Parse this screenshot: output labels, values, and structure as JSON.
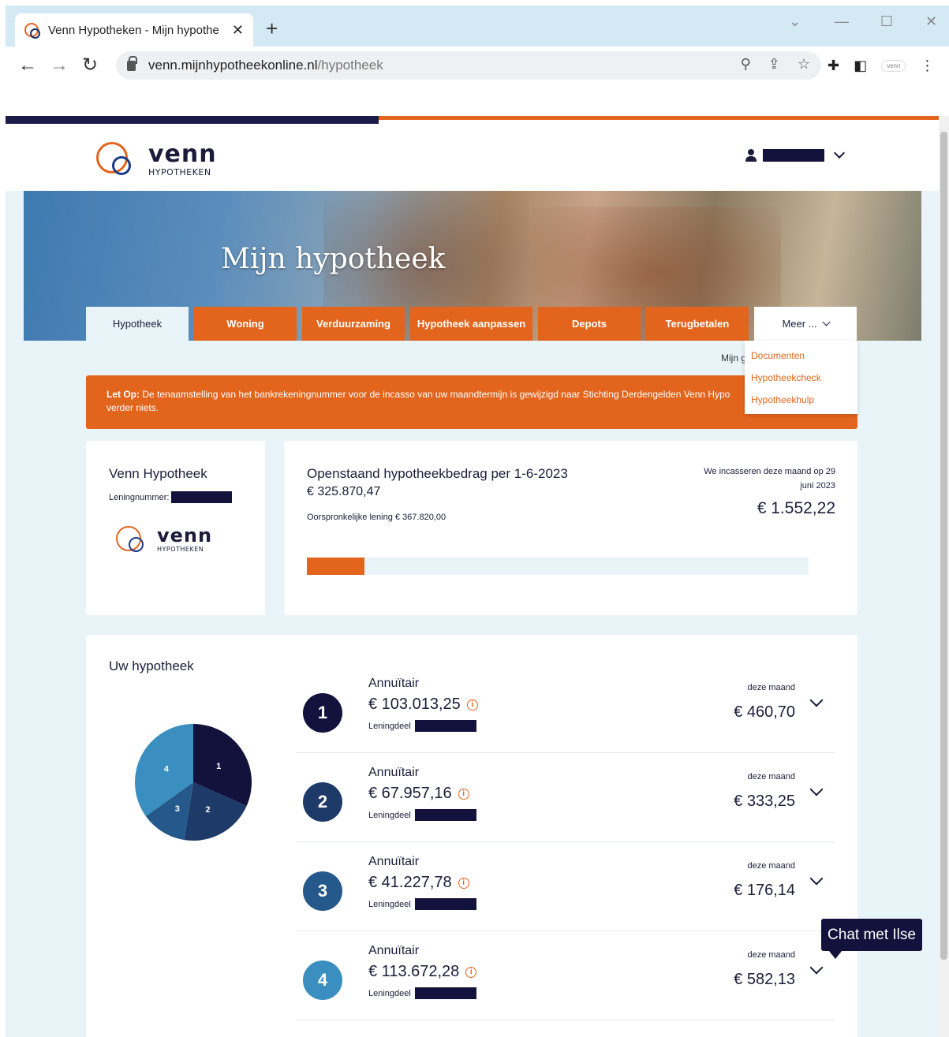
{
  "browser": {
    "tab_title": "Venn Hypotheken - Mijn hypothe",
    "close_label": "✕",
    "new_tab_label": "+",
    "url_host": "venn.mijnhypotheekonline.nl",
    "url_path": "/hypotheek",
    "ext_label": "venn"
  },
  "header": {
    "logo_word": "venn",
    "logo_sub": "HYPOTHEKEN"
  },
  "hero": {
    "title": "Mijn hypotheek"
  },
  "nav": {
    "tabs": [
      {
        "label": "Hypotheek",
        "active": true
      },
      {
        "label": "Woning"
      },
      {
        "label": "Verduurzaming"
      },
      {
        "label": "Hypotheek aanpassen"
      },
      {
        "label": "Depots"
      },
      {
        "label": "Terugbetalen"
      },
      {
        "label": "Meer ..."
      }
    ],
    "dropdown": [
      "Documenten",
      "Hypotheekcheck",
      "Hypotheekhulp"
    ],
    "breadcrumb": "Mijn g"
  },
  "alert": {
    "bold": "Let Op:",
    "text": " De tenaamstelling van het bankrekeningnummer voor de incasso van uw maandtermijn is gewijzigd naar Stichting Derdengelden Venn Hypo",
    "text2": "verder niets."
  },
  "summary": {
    "lender": "Venn Hypotheek",
    "loan_number_label": "Leningnummer:",
    "outstanding_label": "Openstaand hypotheekbedrag per 1-6-2023",
    "outstanding_amount": "€ 325.870,47",
    "original_loan": "Oorspronkelijke lening € 367.820,00",
    "collect_line1": "We incasseren deze maand op 29",
    "collect_line2": "juni 2023",
    "monthly_amount": "€ 1.552,22",
    "repaid_fraction": 0.114
  },
  "mortgage": {
    "title": "Uw hypotheek",
    "parts": [
      {
        "number": "1",
        "type": "Annuïtair",
        "amount": "€ 103.013,25",
        "leningdeel": "Leningdeel",
        "month_label": "deze maand",
        "month_amount": "€ 460,70",
        "color": "#12123d",
        "value": 103013.25
      },
      {
        "number": "2",
        "type": "Annuïtair",
        "amount": "€ 67.957,16",
        "leningdeel": "Leningdeel",
        "month_label": "deze maand",
        "month_amount": "€ 333,25",
        "color": "#1d3a68",
        "value": 67957.16
      },
      {
        "number": "3",
        "type": "Annuïtair",
        "amount": "€ 41.227,78",
        "leningdeel": "Leningdeel",
        "month_label": "deze maand",
        "month_amount": "€ 176,14",
        "color": "#25598b",
        "value": 41227.78
      },
      {
        "number": "4",
        "type": "Annuïtair",
        "amount": "€ 113.672,28",
        "leningdeel": "Leningdeel",
        "month_label": "deze maand",
        "month_amount": "€ 582,13",
        "color": "#3a8ec0",
        "value": 113672.28
      }
    ],
    "info_icon": "i"
  },
  "chat": {
    "label": "Chat met Ilse"
  }
}
